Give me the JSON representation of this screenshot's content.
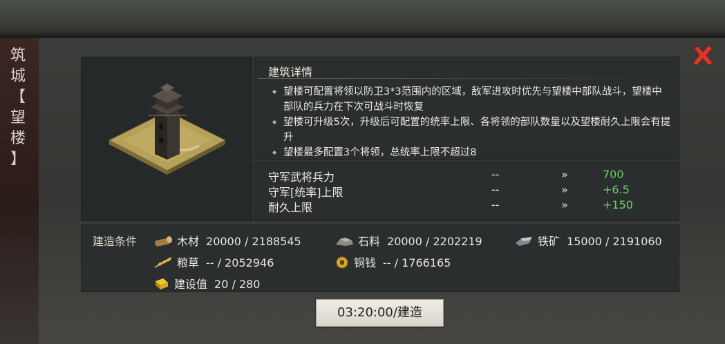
{
  "side_title": [
    "筑",
    "城",
    "【",
    "望",
    "楼",
    "】"
  ],
  "detail": {
    "heading": "建筑详情",
    "items": [
      "望楼可配置将领以防卫3*3范围内的区域，敌军进攻时优先与望楼中部队战斗，望楼中部队的兵力在下次可战斗时恢复",
      "望楼可升级5次，升级后可配置的统率上限、各将领的部队数量以及望楼耐久上限会有提升",
      "望楼最多配置3个将领，总统率上限不超过8"
    ]
  },
  "stats": [
    {
      "label": "守军武将兵力",
      "current": "--",
      "arrow": "»",
      "next": "700"
    },
    {
      "label": "守军[统率]上限",
      "current": "--",
      "arrow": "»",
      "next": "+6.5"
    },
    {
      "label": "耐久上限",
      "current": "--",
      "arrow": "»",
      "next": "+150"
    }
  ],
  "requirements": {
    "label": "建造条件",
    "items": [
      {
        "icon": "wood-icon",
        "name": "木材",
        "value": "20000 / 2188545"
      },
      {
        "icon": "stone-icon",
        "name": "石料",
        "value": "20000 / 2202219"
      },
      {
        "icon": "iron-ore-icon",
        "name": "铁矿",
        "value": "15000 / 2191060"
      },
      {
        "icon": "grain-icon",
        "name": "粮草",
        "value": "-- / 2052946"
      },
      {
        "icon": "copper-coin-icon",
        "name": "铜钱",
        "value": "-- / 1766165"
      },
      {
        "icon": "construction-value-icon",
        "name": "建设值",
        "value": "20 / 280"
      }
    ]
  },
  "build_button": "03:20:00/建造",
  "colors": {
    "next_value": "#6fd15e",
    "close": "#d63a2a"
  }
}
